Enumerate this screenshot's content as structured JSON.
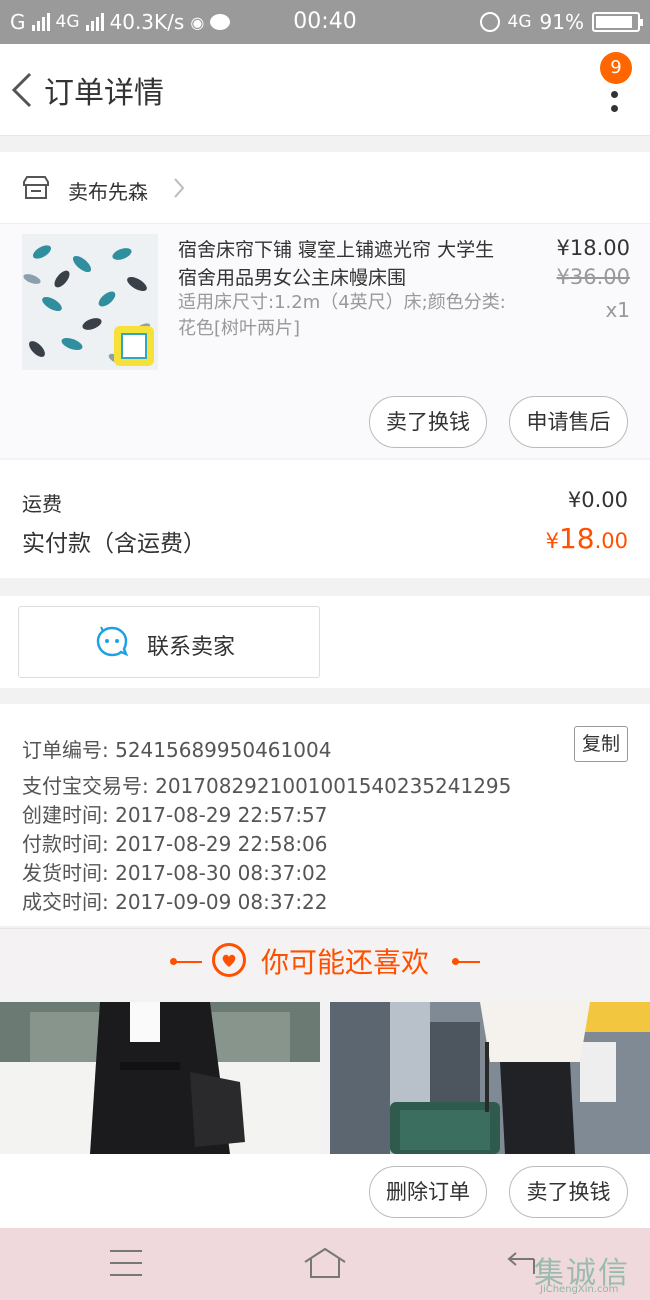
{
  "status_bar": {
    "carrier": "G",
    "network": "4G",
    "speed": "40.3K/s",
    "time": "00:40",
    "network_right": "4G",
    "battery": "91%",
    "battery_level": 0.91
  },
  "nav": {
    "title": "订单详情",
    "badge": "9"
  },
  "shop": {
    "name": "卖布先森"
  },
  "product": {
    "title": "宿舍床帘下铺 寝室上铺遮光帘 大学生宿舍用品男女公主床幔床围",
    "spec": "适用床尺寸:1.2m（4英尺）床;颜色分类:花色[树叶两片]",
    "price": "¥18.00",
    "original_price": "¥36.00",
    "quantity": "x1"
  },
  "item_actions": {
    "sell": "卖了换钱",
    "after_sale": "申请售后"
  },
  "fees": {
    "shipping_label": "运费",
    "shipping_value": "¥0.00",
    "paid_label": "实付款（含运费）",
    "paid_currency": "¥",
    "paid_int": "18",
    "paid_dec": ".00"
  },
  "contact": {
    "label": "联系卖家"
  },
  "order_info": {
    "order_no": "订单编号: 52415689950461004",
    "alipay_no": "支付宝交易号: 2017082921001001540235241295",
    "created": "创建时间: 2017-08-29 22:57:57",
    "paid": "付款时间: 2017-08-29 22:58:06",
    "shipped": "发货时间: 2017-08-30 08:37:02",
    "completed": "成交时间: 2017-09-09 08:37:22",
    "copy_label": "复制"
  },
  "recommend": {
    "title": "你可能还喜欢"
  },
  "bottom_actions": {
    "delete": "删除订单",
    "sell": "卖了换钱"
  },
  "watermark": {
    "text": "集诚信",
    "sub": "JiChengXin.com"
  },
  "colors": {
    "accent": "#ff5000",
    "badge": "#ff6600",
    "status_bar": "#9a9a9a"
  }
}
